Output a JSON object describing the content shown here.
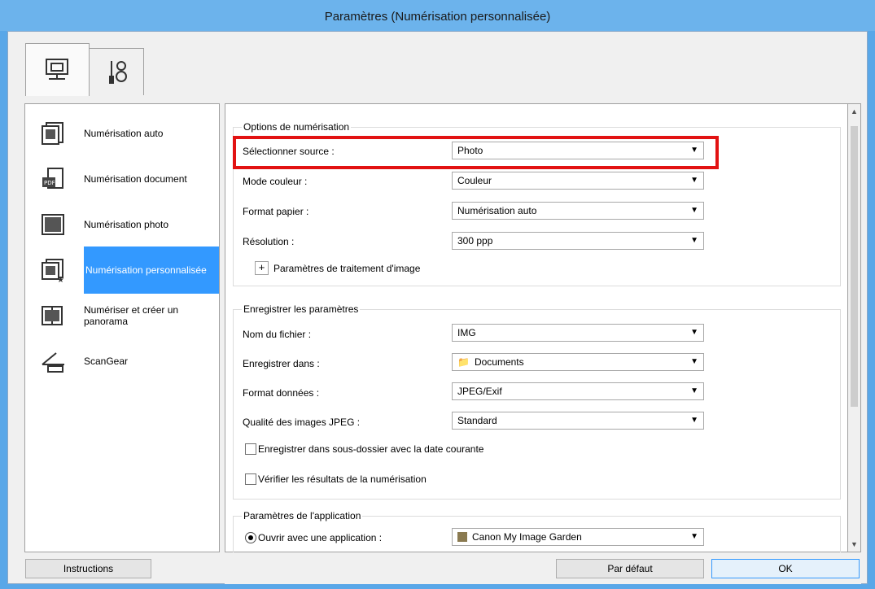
{
  "window": {
    "title": "Paramètres (Numérisation personnalisée)"
  },
  "sidebar": {
    "items": [
      {
        "label": "Numérisation auto",
        "icon": "auto-scan-icon"
      },
      {
        "label": "Numérisation document",
        "icon": "document-scan-icon"
      },
      {
        "label": "Numérisation photo",
        "icon": "photo-scan-icon"
      },
      {
        "label": "Numérisation personnalisée",
        "icon": "custom-scan-icon",
        "active": true
      },
      {
        "label": "Numériser et créer un panorama",
        "icon": "panorama-icon"
      },
      {
        "label": "ScanGear",
        "icon": "scangear-icon"
      }
    ]
  },
  "scan_options": {
    "title": "Options de numérisation",
    "select_source_label": "Sélectionner source :",
    "select_source_value": "Photo",
    "color_mode_label": "Mode couleur :",
    "color_mode_value": "Couleur",
    "paper_size_label": "Format papier :",
    "paper_size_value": "Numérisation auto",
    "resolution_label": "Résolution :",
    "resolution_value": "300 ppp",
    "image_processing_label": "Paramètres de traitement d'image"
  },
  "save_settings": {
    "title": "Enregistrer les paramètres",
    "file_name_label": "Nom du fichier :",
    "file_name_value": "IMG",
    "save_in_label": "Enregistrer dans :",
    "save_in_value": "Documents",
    "data_format_label": "Format données :",
    "data_format_value": "JPEG/Exif",
    "jpeg_quality_label": "Qualité des images JPEG :",
    "jpeg_quality_value": "Standard",
    "subfolder_label": "Enregistrer dans sous-dossier avec la date courante",
    "check_results_label": "Vérifier les résultats de la numérisation"
  },
  "app_settings": {
    "title": "Paramètres de l'application",
    "open_with_label": "Ouvrir avec une application :",
    "open_with_value": "Canon My Image Garden"
  },
  "buttons": {
    "instructions": "Instructions",
    "default": "Par défaut",
    "ok": "OK"
  },
  "colors": {
    "titlebar": "#6cb3ec",
    "selection": "#3399ff",
    "highlight": "#e21212"
  }
}
